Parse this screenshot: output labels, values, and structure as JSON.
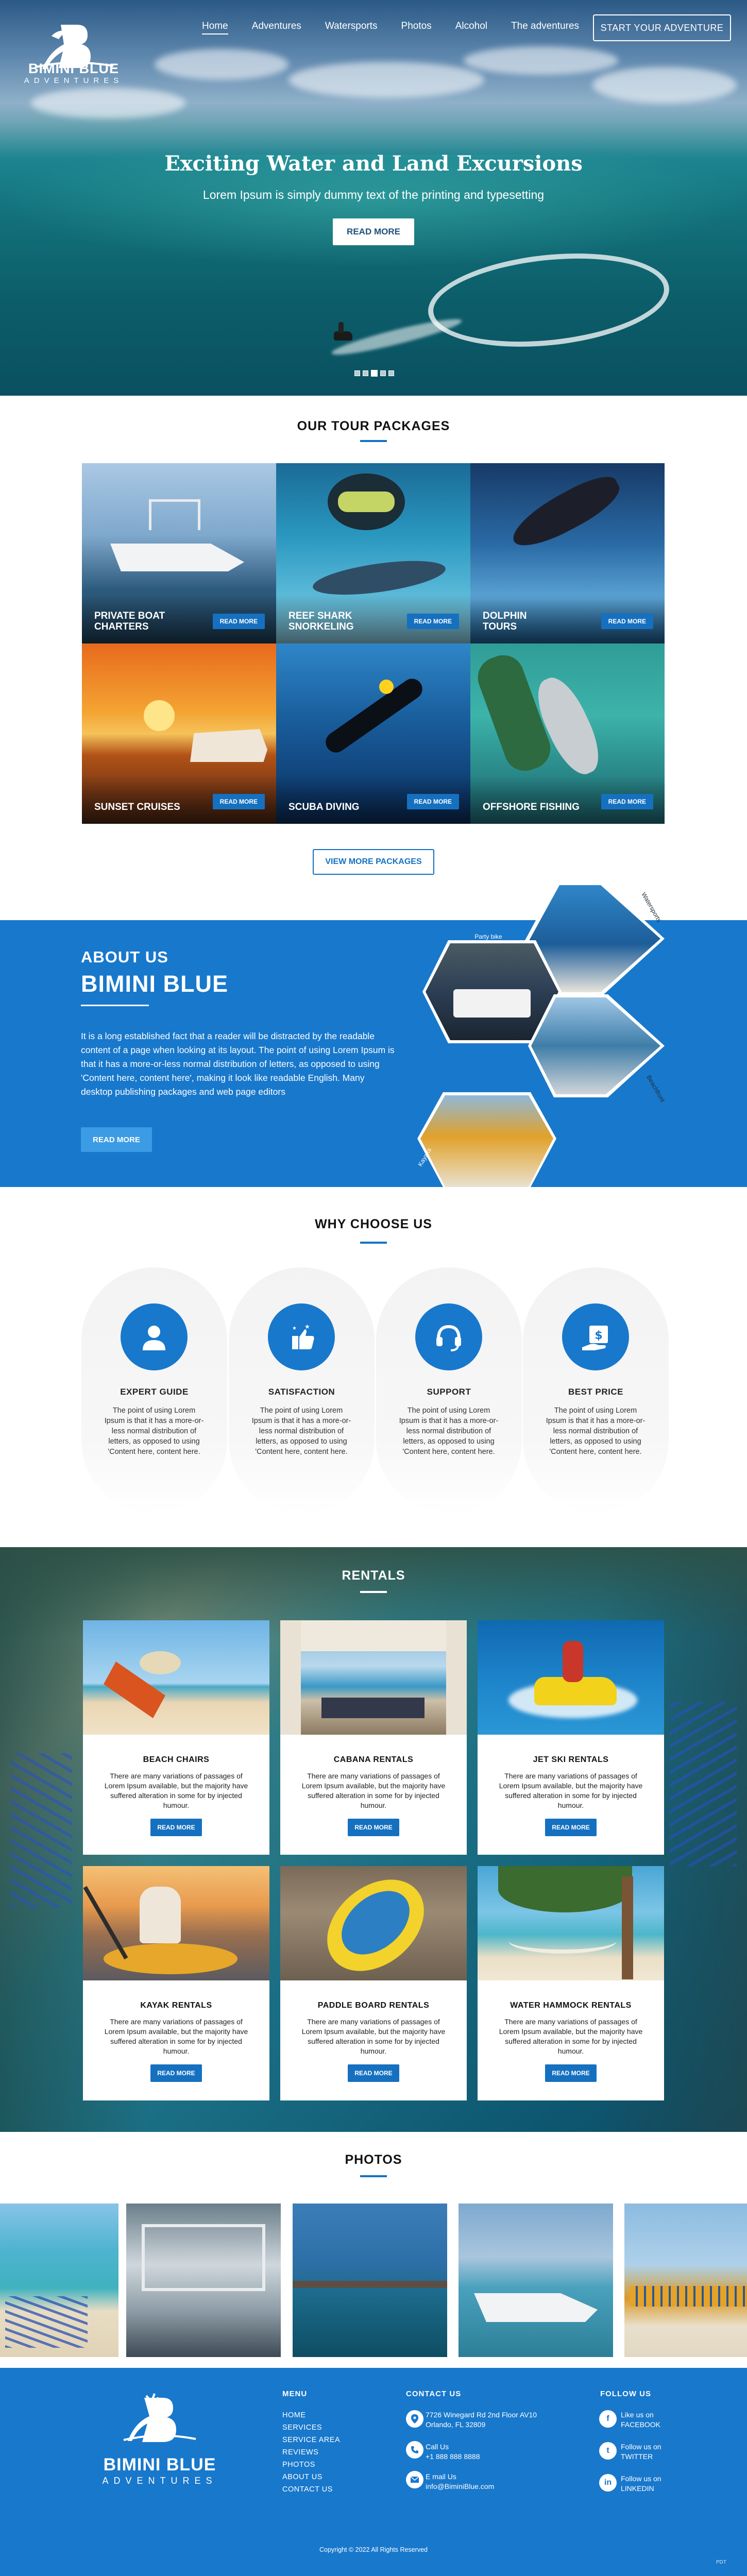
{
  "header": {
    "logo_title": "BIMINI BLUE",
    "logo_sub": "ADVENTURES",
    "nav": [
      "Home",
      "Adventures",
      "Watersports",
      "Photos",
      "Alcohol",
      "The adventures"
    ],
    "cta": "START YOUR ADVENTURE"
  },
  "hero": {
    "title": "Exciting Water and Land Excursions",
    "subtitle": "Lorem Ipsum is simply dummy text of the printing and typesetting",
    "button": "READ MORE",
    "slides": 5,
    "active_slide": 3
  },
  "tours": {
    "title": "OUR TOUR PACKAGES",
    "items": [
      {
        "line1": "PRIVATE BOAT",
        "line2": "CHARTERS",
        "button": "READ MORE"
      },
      {
        "line1": "REEF SHARK",
        "line2": "SNORKELING",
        "button": "READ MORE"
      },
      {
        "line1": "DOLPHIN",
        "line2": "TOURS",
        "button": "READ MORE"
      },
      {
        "line1": "SUNSET CRUISES",
        "line2": "",
        "button": "READ MORE"
      },
      {
        "line1": "SCUBA DIVING",
        "line2": "",
        "button": "READ MORE"
      },
      {
        "line1": "OFFSHORE FISHING",
        "line2": "",
        "button": "READ MORE"
      }
    ],
    "view_more": "VIEW MORE PACKAGES"
  },
  "about": {
    "small": "ABOUT US",
    "big": "BIMINI BLUE",
    "text": "It is a long established fact that a reader will be distracted by the readable content of a page when looking at its layout. The point of using Lorem Ipsum is that it has a more-or-less normal distribution of letters, as opposed to using 'Content here, content here', making it look like readable English. Many desktop publishing packages and web page editors",
    "button": "READ MORE",
    "hex_labels": [
      "Watersports",
      "Party bike",
      "Beachfront",
      "Kayaks"
    ]
  },
  "why": {
    "title": "WHY CHOOSE US",
    "items": [
      {
        "title": "EXPERT GUIDE",
        "text": "The point of using Lorem Ipsum is that it has a more-or-less normal distribution of letters, as opposed to using 'Content here, content here."
      },
      {
        "title": "SATISFACTION",
        "text": "The point of using Lorem Ipsum is that it has a more-or-less normal distribution of letters, as opposed to using 'Content here, content here."
      },
      {
        "title": "SUPPORT",
        "text": "The point of using Lorem Ipsum is that it has a more-or-less normal distribution of letters, as opposed to using 'Content here, content here."
      },
      {
        "title": "BEST PRICE",
        "text": "The point of using Lorem Ipsum is that it has a more-or-less normal distribution of letters, as opposed to using 'Content here, content here."
      }
    ]
  },
  "rentals": {
    "title": "RENTALS",
    "items": [
      {
        "title": "BEACH CHAIRS",
        "text": "There are many variations of passages of Lorem Ipsum available, but the majority have suffered alteration in some for by injected humour.",
        "button": "READ MORE"
      },
      {
        "title": "CABANA RENTALS",
        "text": "There are many variations of passages of Lorem Ipsum available, but the majority have suffered alteration in some for by injected humour.",
        "button": "READ MORE"
      },
      {
        "title": "JET SKI RENTALS",
        "text": "There are many variations of passages of Lorem Ipsum available, but the majority have suffered alteration in some for by injected humour.",
        "button": "READ MORE"
      },
      {
        "title": "KAYAK RENTALS",
        "text": "There are many variations of passages of Lorem Ipsum available, but the majority have suffered alteration in some for by injected humour.",
        "button": "READ MORE"
      },
      {
        "title": "PADDLE BOARD RENTALS",
        "text": "There are many variations of passages of Lorem Ipsum available, but the majority have suffered alteration in some for by injected humour.",
        "button": "READ MORE"
      },
      {
        "title": "WATER HAMMOCK RENTALS",
        "text": "There are many variations of passages of Lorem Ipsum available, but the majority have suffered alteration in some for by injected humour.",
        "button": "READ MORE"
      }
    ]
  },
  "photos": {
    "title": "PHOTOS"
  },
  "footer": {
    "logo_title": "BIMINI BLUE",
    "logo_sub": "ADVENTURES",
    "menu_title": "MENU",
    "menu": [
      "HOME",
      "SERVICES",
      "SERVICE AREA",
      "REVIEWS",
      "PHOTOS",
      "ABOUT US",
      "CONTACT US"
    ],
    "contact_title": "CONTACT US",
    "address_1": "7726 Winegard Rd 2nd Floor AV10",
    "address_2": "Orlando, FL 32809",
    "call_label": "Call Us",
    "phone": "+1 888 888 8888",
    "email_label": "E mail Us",
    "email": "info@BiminiBlue.com",
    "follow_title": "FOLLOW US",
    "social": [
      {
        "label": "Like us on",
        "name": "FACEBOOK",
        "icon": "f"
      },
      {
        "label": "Follow us on",
        "name": "TWITTER",
        "icon": "t"
      },
      {
        "label": "Follow us on",
        "name": "LINKEDIN",
        "icon": "in"
      }
    ],
    "copyright": "Copyright © 2022 All Rights Reserved",
    "corner": "PDT"
  },
  "colors": {
    "brand_blue": "#1878cc",
    "button_blue": "#1670c0",
    "hero_sea": "#12707a"
  }
}
